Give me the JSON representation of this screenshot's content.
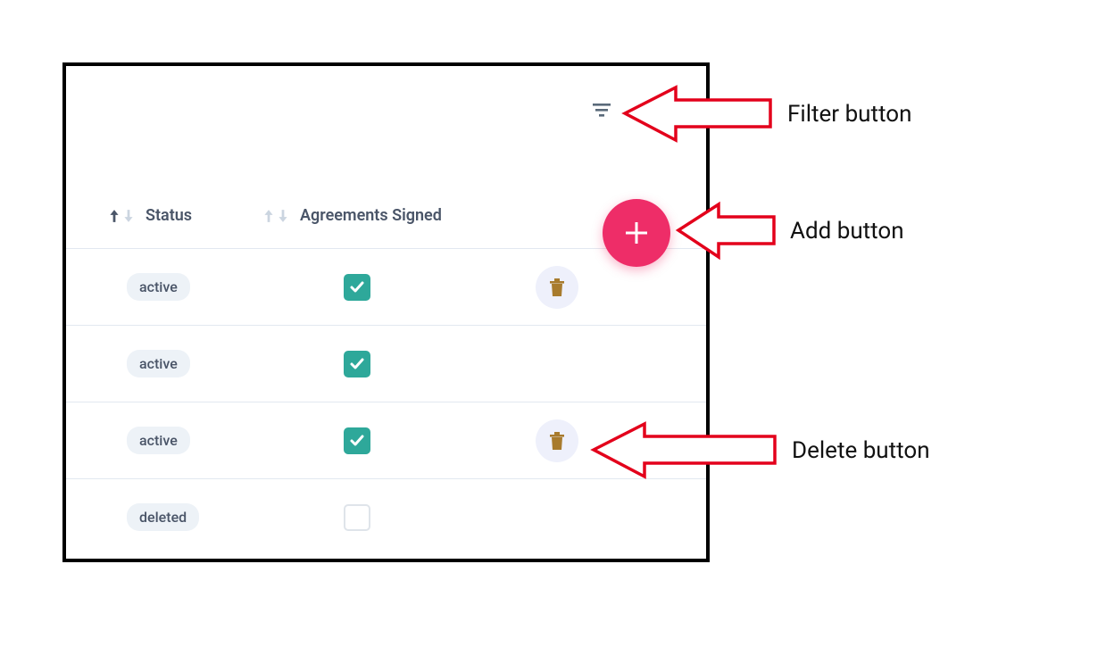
{
  "columns": {
    "status_label": "Status",
    "agreements_label": "Agreements Signed"
  },
  "rows": [
    {
      "status": "active",
      "agreements_signed": true,
      "show_delete": true
    },
    {
      "status": "active",
      "agreements_signed": true,
      "show_delete": false
    },
    {
      "status": "active",
      "agreements_signed": true,
      "show_delete": true
    },
    {
      "status": "deleted",
      "agreements_signed": false,
      "show_delete": false
    }
  ],
  "annotations": {
    "filter": "Filter button",
    "add": "Add button",
    "delete": "Delete button"
  },
  "colors": {
    "accent_pink": "#ee2d68",
    "accent_teal": "#2ea89a",
    "badge_bg": "#edf2f7",
    "delete_bg": "#eef0fb",
    "trash_fill": "#a87b2d",
    "text_muted": "#4a5568",
    "border_light": "#e2e8f0",
    "annotation_red": "#e3001b"
  },
  "icons": {
    "filter": "filter-icon",
    "plus": "plus-icon",
    "trash": "trash-icon",
    "check": "check-icon",
    "sort_up": "arrow-up-icon",
    "sort_down": "arrow-down-icon"
  }
}
